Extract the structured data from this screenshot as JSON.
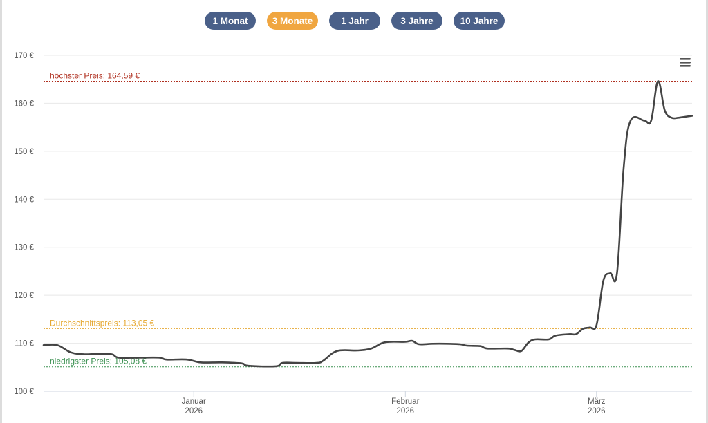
{
  "range_buttons": [
    {
      "label": "1 Monat",
      "active": false
    },
    {
      "label": "3 Monate",
      "active": true
    },
    {
      "label": "1 Jahr",
      "active": false
    },
    {
      "label": "3 Jahre",
      "active": false
    },
    {
      "label": "10 Jahre",
      "active": false
    }
  ],
  "colors": {
    "button": "#4a6089",
    "button_active": "#f0a640",
    "line": "#444444",
    "max_line": "#b03020",
    "avg_line": "#e6a830",
    "min_line": "#3a9050",
    "grid": "#e8e8e8",
    "axis_text": "#555555"
  },
  "menu_icon": "hamburger-menu-icon",
  "chart_data": {
    "type": "line",
    "ylim": [
      100,
      170
    ],
    "y_ticks": [
      {
        "value": 170,
        "label": "170 €"
      },
      {
        "value": 160,
        "label": "160 €"
      },
      {
        "value": 150,
        "label": "150 €"
      },
      {
        "value": 140,
        "label": "140 €"
      },
      {
        "value": 130,
        "label": "130 €"
      },
      {
        "value": 120,
        "label": "120 €"
      },
      {
        "value": 110,
        "label": "110 €"
      },
      {
        "value": 100,
        "label": "100 €"
      }
    ],
    "x_range": [
      "2025-12-10",
      "2026-03-15"
    ],
    "x_ticks": [
      {
        "date": "2026-01-01",
        "label": "Januar",
        "sublabel": "2026"
      },
      {
        "date": "2026-02-01",
        "label": "Februar",
        "sublabel": "2026"
      },
      {
        "date": "2026-03-01",
        "label": "März",
        "sublabel": "2026"
      }
    ],
    "reference_lines": [
      {
        "value": 164.59,
        "label": "höchster Preis: 164,59 €",
        "kind": "max"
      },
      {
        "value": 113.05,
        "label": "Durchschnittspreis: 113,05 €",
        "kind": "avg"
      },
      {
        "value": 105.08,
        "label": "niedrigster Preis: 105,08 €",
        "kind": "min"
      }
    ],
    "series": [
      {
        "points": [
          [
            "2025-12-10",
            109.6
          ],
          [
            "2025-12-12",
            109.6
          ],
          [
            "2025-12-14",
            108.1
          ],
          [
            "2025-12-16",
            107.7
          ],
          [
            "2025-12-18",
            107.8
          ],
          [
            "2025-12-20",
            107.7
          ],
          [
            "2025-12-21",
            107.0
          ],
          [
            "2025-12-24",
            107.0
          ],
          [
            "2025-12-27",
            107.0
          ],
          [
            "2025-12-28",
            106.6
          ],
          [
            "2025-12-31",
            106.6
          ],
          [
            "2026-01-02",
            106.0
          ],
          [
            "2026-01-05",
            106.0
          ],
          [
            "2026-01-08",
            105.8
          ],
          [
            "2026-01-09",
            105.3
          ],
          [
            "2026-01-13",
            105.2
          ],
          [
            "2026-01-14",
            105.9
          ],
          [
            "2026-01-16",
            105.9
          ],
          [
            "2026-01-19",
            105.9
          ],
          [
            "2026-01-20",
            106.4
          ],
          [
            "2026-01-22",
            108.4
          ],
          [
            "2026-01-25",
            108.5
          ],
          [
            "2026-01-27",
            108.9
          ],
          [
            "2026-01-29",
            110.2
          ],
          [
            "2026-02-01",
            110.3
          ],
          [
            "2026-02-02",
            110.5
          ],
          [
            "2026-02-03",
            109.8
          ],
          [
            "2026-02-05",
            109.9
          ],
          [
            "2026-02-07",
            109.9
          ],
          [
            "2026-02-09",
            109.8
          ],
          [
            "2026-02-10",
            109.5
          ],
          [
            "2026-02-12",
            109.4
          ],
          [
            "2026-02-13",
            108.9
          ],
          [
            "2026-02-16",
            108.9
          ],
          [
            "2026-02-17",
            108.6
          ],
          [
            "2026-02-18",
            108.4
          ],
          [
            "2026-02-19",
            110.1
          ],
          [
            "2026-02-20",
            110.8
          ],
          [
            "2026-02-22",
            110.8
          ],
          [
            "2026-02-23",
            111.6
          ],
          [
            "2026-02-25",
            111.9
          ],
          [
            "2026-02-26",
            111.9
          ],
          [
            "2026-02-27",
            113.0
          ],
          [
            "2026-02-28",
            113.3
          ],
          [
            "2026-03-01",
            113.8
          ],
          [
            "2026-03-02",
            123.0
          ],
          [
            "2026-03-03",
            124.6
          ],
          [
            "2026-03-04",
            124.6
          ],
          [
            "2026-03-05",
            147.0
          ],
          [
            "2026-03-06",
            156.4
          ],
          [
            "2026-03-08",
            156.4
          ],
          [
            "2026-03-09",
            156.4
          ],
          [
            "2026-03-10",
            164.59
          ],
          [
            "2026-03-11",
            158.5
          ],
          [
            "2026-03-12",
            157.0
          ],
          [
            "2026-03-13",
            157.0
          ],
          [
            "2026-03-14",
            157.2
          ],
          [
            "2026-03-15",
            157.4
          ]
        ]
      }
    ]
  }
}
